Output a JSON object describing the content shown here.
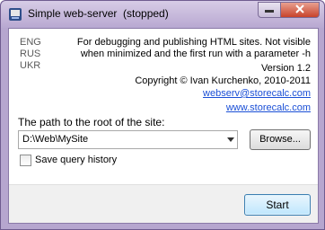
{
  "window": {
    "title": "Simple web-server  (stopped)",
    "icons": {
      "app": "app-icon",
      "minimize": "minimize-icon",
      "close": "close-icon"
    }
  },
  "languages": [
    "ENG",
    "RUS",
    "UKR"
  ],
  "info": {
    "description_line1": "For debugging and publishing HTML sites. Not visible",
    "description_line2": "when minimized and the first run with a parameter -h",
    "version": "Version 1.2",
    "copyright": "Copyright © Ivan Kurchenko, 2010-2011",
    "email": "webserv@storecalc.com",
    "website": "www.storecalc.com"
  },
  "path": {
    "label": "The path to the root of the site:",
    "value": "D:\\Web\\MySite",
    "browse_label": "Browse..."
  },
  "options": {
    "save_query_history_label": "Save query history",
    "save_query_history_checked": false
  },
  "actions": {
    "start_label": "Start"
  },
  "colors": {
    "link": "#1a4fd6",
    "window_frame": "#b6a6cf",
    "close_button": "#c8432b"
  }
}
